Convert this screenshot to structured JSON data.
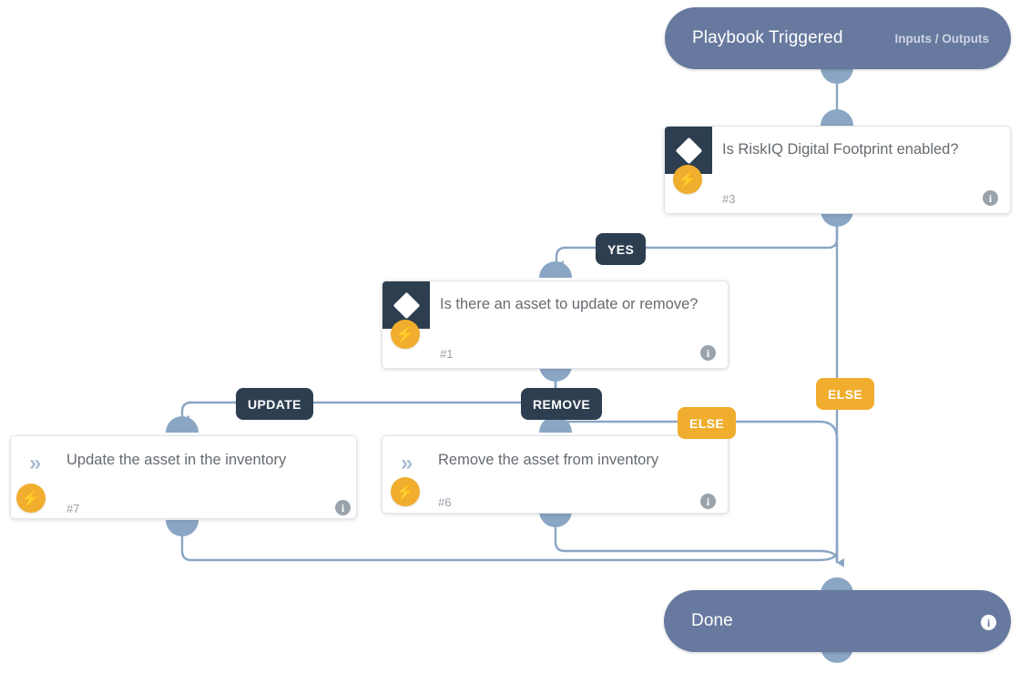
{
  "canvas": {
    "background_color": "#ffffff",
    "edge_color": "#8aa6c4"
  },
  "nodes": [
    {
      "id": "trigger",
      "type": "terminal",
      "title": "Playbook Triggered",
      "right_label": "Inputs / Outputs",
      "color": "#67799f"
    },
    {
      "id": "node3",
      "type": "decision",
      "title": "Is RiskIQ Digital Footprint enabled?",
      "number": "#3",
      "icon": "diamond-icon",
      "badge_icon": "lightning-bolt-icon",
      "info_icon": "info-icon"
    },
    {
      "id": "node1",
      "type": "decision",
      "title": "Is there an asset to update or remove?",
      "number": "#1",
      "icon": "diamond-icon",
      "badge_icon": "lightning-bolt-icon",
      "info_icon": "info-icon"
    },
    {
      "id": "node7",
      "type": "action",
      "title": "Update the asset in the inventory",
      "number": "#7",
      "icon": "chevron-right-icon",
      "badge_icon": "lightning-bolt-icon",
      "info_icon": "info-icon"
    },
    {
      "id": "node6",
      "type": "action",
      "title": "Remove the asset from inventory",
      "number": "#6",
      "icon": "chevron-right-icon",
      "badge_icon": "lightning-bolt-icon",
      "info_icon": "info-icon"
    },
    {
      "id": "done",
      "type": "terminal",
      "title": "Done",
      "info_icon": "info-icon",
      "color": "#67799f"
    }
  ],
  "edge_labels": [
    {
      "id": "yes",
      "text": "YES",
      "style": "dark",
      "color": "#2d3e50"
    },
    {
      "id": "else_top",
      "text": "ELSE",
      "style": "orange",
      "color": "#f0ad2e"
    },
    {
      "id": "update",
      "text": "UPDATE",
      "style": "dark",
      "color": "#2d3e50"
    },
    {
      "id": "remove",
      "text": "REMOVE",
      "style": "dark",
      "color": "#2d3e50"
    },
    {
      "id": "else_mid",
      "text": "ELSE",
      "style": "orange",
      "color": "#f0ad2e"
    }
  ],
  "glyphs": {
    "bolt": "⚡",
    "chevron": "»",
    "info": "i"
  }
}
